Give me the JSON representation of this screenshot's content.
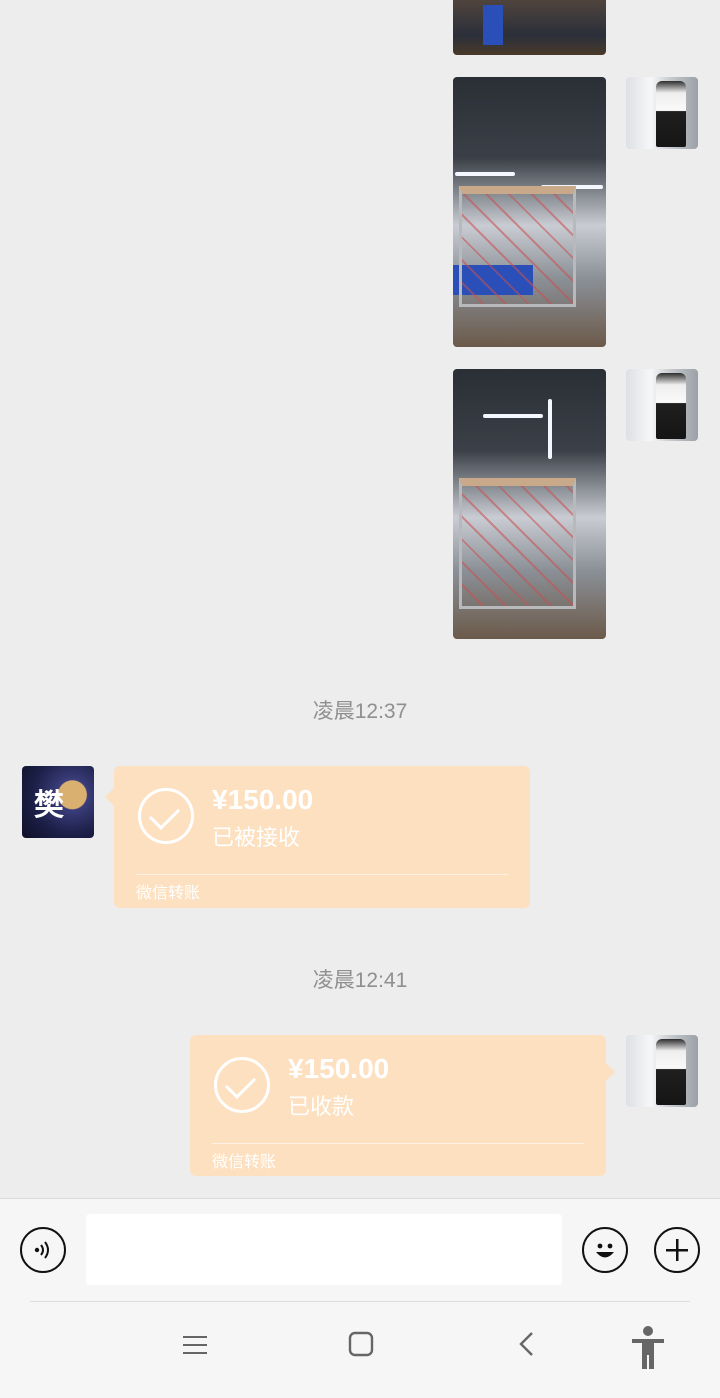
{
  "messages": {
    "time_1": "凌晨12:37",
    "time_2": "凌晨12:41",
    "transfer_received": {
      "amount": "¥150.00",
      "status": "已被接收",
      "footer": "微信转账"
    },
    "transfer_sent": {
      "amount": "¥150.00",
      "status": "已收款",
      "footer": "微信转账"
    },
    "left_avatar_glyph": "樊"
  },
  "input": {
    "value": "",
    "placeholder": ""
  },
  "icons": {
    "voice": "voice-icon",
    "emoji": "emoji-icon",
    "plus": "plus-icon",
    "nav_menu": "menu-icon",
    "nav_home": "home-icon",
    "nav_back": "back-icon",
    "nav_accessibility": "accessibility-icon"
  },
  "colors": {
    "background": "#ededed",
    "transfer_bubble": "#fde0c0",
    "time_text": "#8f8f8f"
  }
}
